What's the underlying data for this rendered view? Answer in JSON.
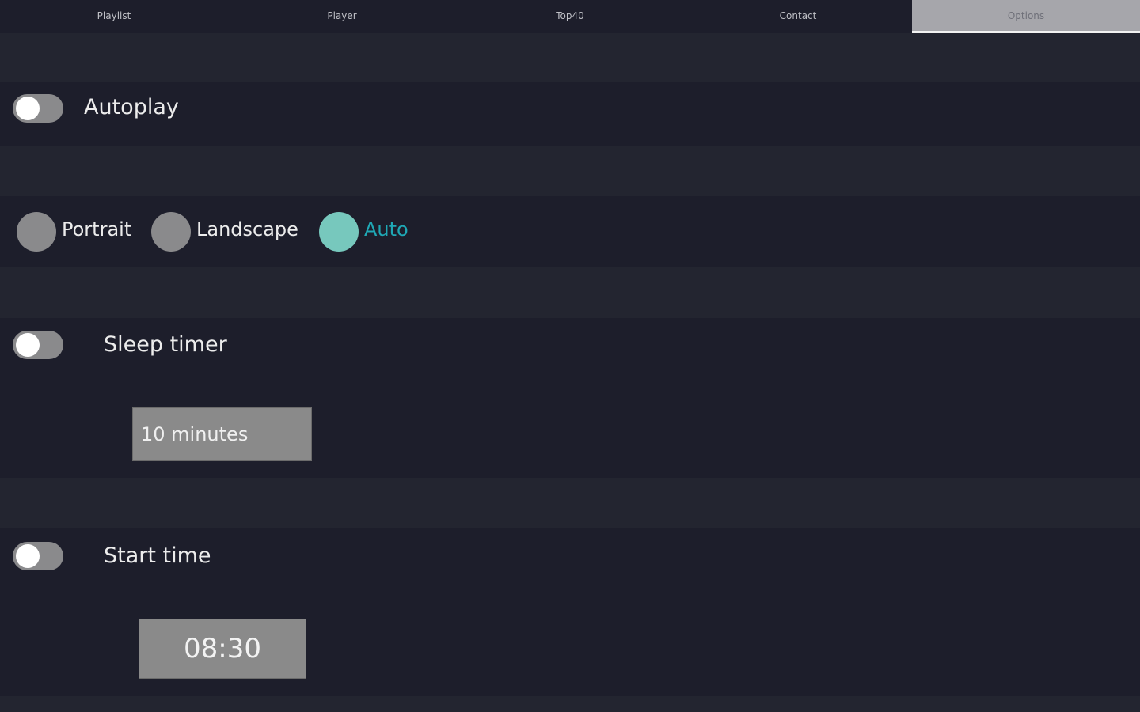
{
  "tabs": [
    {
      "label": "Playlist",
      "active": false
    },
    {
      "label": "Player",
      "active": false
    },
    {
      "label": "Top40",
      "active": false
    },
    {
      "label": "Contact",
      "active": false
    },
    {
      "label": "Options",
      "active": true
    }
  ],
  "autoplay": {
    "label": "Autoplay",
    "enabled": false
  },
  "orientation": {
    "options": [
      "Portrait",
      "Landscape",
      "Auto"
    ],
    "selected": "Auto"
  },
  "sleep_timer": {
    "label": "Sleep timer",
    "enabled": false,
    "value": "10 minutes"
  },
  "start_time": {
    "label": "Start time",
    "enabled": false,
    "value": "08:30"
  },
  "colors": {
    "background": "#1d1e2b",
    "accent": "#77c8bd",
    "accent_text": "#1fa8b5",
    "control_gray": "#8a8a8c"
  }
}
